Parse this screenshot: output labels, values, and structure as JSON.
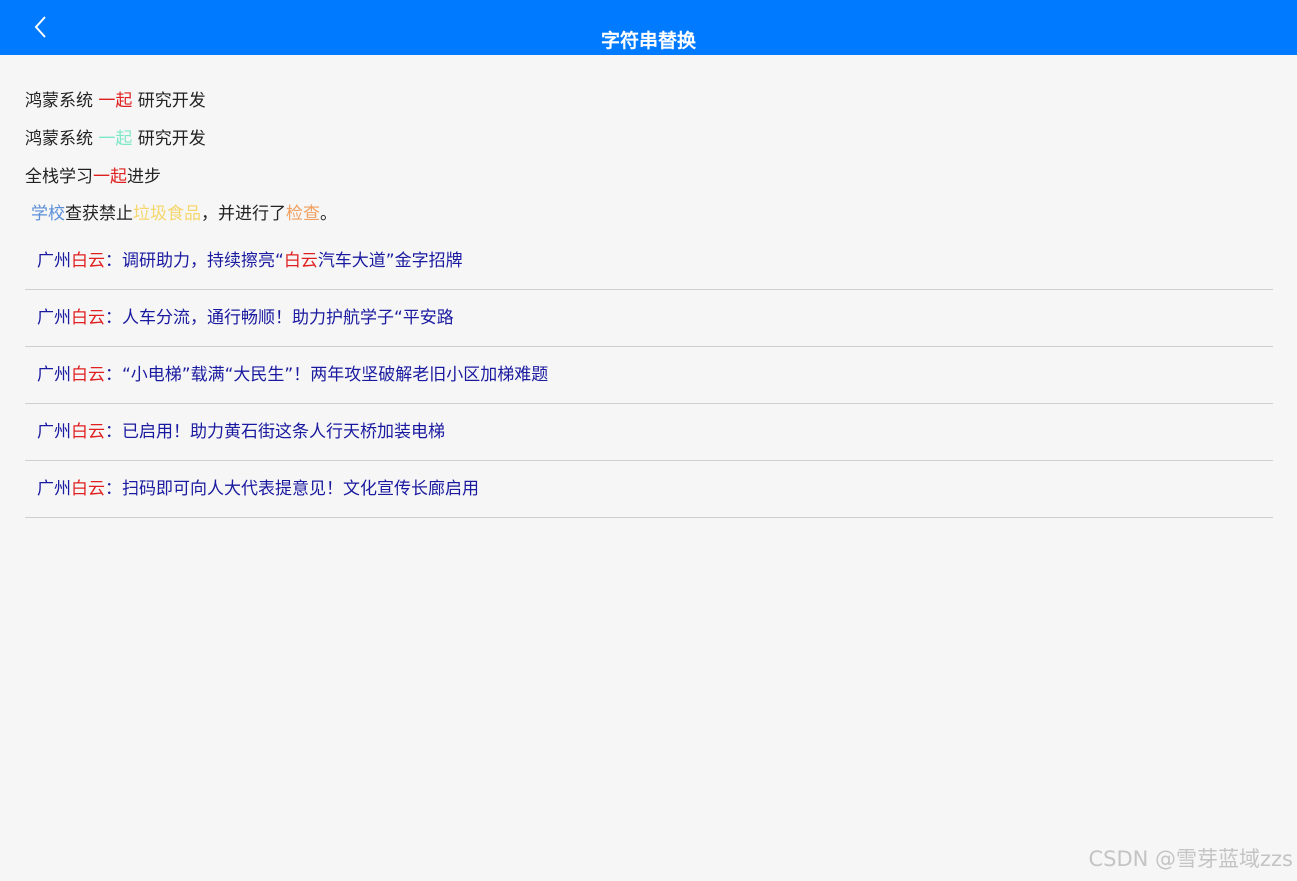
{
  "navbar": {
    "title": "字符串替换",
    "back_icon": "chevron-left-icon",
    "background_color": "#007aff"
  },
  "lines": [
    {
      "parts": [
        {
          "text": "鸿蒙系统 ",
          "color": "#222222"
        },
        {
          "text": "一起",
          "color": "#e02020"
        },
        {
          "text": " 研究开发",
          "color": "#222222"
        }
      ]
    },
    {
      "parts": [
        {
          "text": "鸿蒙系统 ",
          "color": "#222222"
        },
        {
          "text": "一起",
          "color": "#7fe8c8"
        },
        {
          "text": " 研究开发",
          "color": "#222222"
        }
      ]
    },
    {
      "parts": [
        {
          "text": "全栈学习",
          "color": "#222222"
        },
        {
          "text": "一起",
          "color": "#e02020"
        },
        {
          "text": "进步",
          "color": "#222222"
        }
      ]
    },
    {
      "parts": [
        {
          "text": "学校",
          "color": "#5b8fd9"
        },
        {
          "text": "查获禁止",
          "color": "#222222"
        },
        {
          "text": "垃圾食品",
          "color": "#f5d76e"
        },
        {
          "text": "，并进行了",
          "color": "#222222"
        },
        {
          "text": "检查",
          "color": "#f0a060"
        },
        {
          "text": "。",
          "color": "#222222"
        }
      ]
    }
  ],
  "news": [
    {
      "prefix": "广州",
      "highlight": "白云",
      "rest": "：调研助力，持续擦亮“",
      "highlight2": "白云",
      "rest2": "汽车大道”金字招牌"
    },
    {
      "prefix": "广州",
      "highlight": "白云",
      "rest": "：人车分流，通行畅顺！助力护航学子“平安路",
      "highlight2": "",
      "rest2": ""
    },
    {
      "prefix": "广州",
      "highlight": "白云",
      "rest": "：“小电梯”载满“大民生”！两年攻坚破解老旧小区加梯难题",
      "highlight2": "",
      "rest2": ""
    },
    {
      "prefix": "广州",
      "highlight": "白云",
      "rest": "：已启用！助力黄石街这条人行天桥加装电梯",
      "highlight2": "",
      "rest2": ""
    },
    {
      "prefix": "广州",
      "highlight": "白云",
      "rest": "：扫码即可向人大代表提意见！文化宣传长廊启用",
      "highlight2": "",
      "rest2": ""
    }
  ],
  "colors": {
    "news_text": "#1a1aa0",
    "highlight": "#e02020"
  },
  "watermark": "CSDN @雪芽蓝域zzs"
}
